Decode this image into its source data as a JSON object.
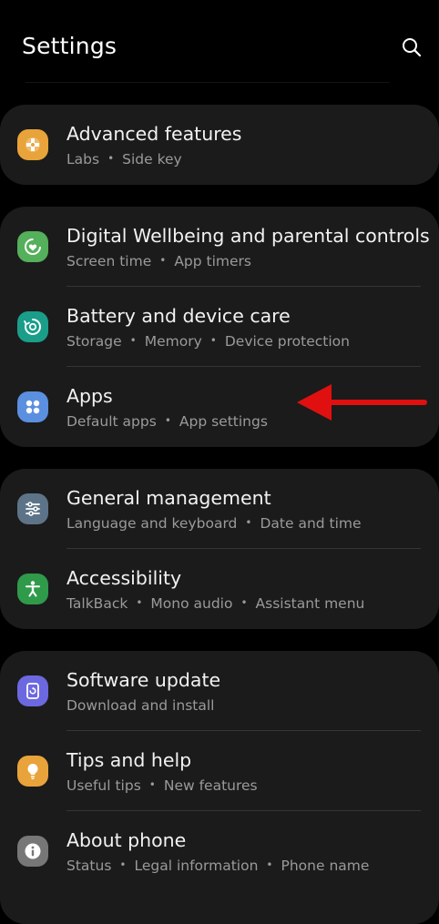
{
  "header": {
    "title": "Settings",
    "search_icon": "search-icon"
  },
  "cards": [
    {
      "items": [
        {
          "title": "Advanced features",
          "subtitle": [
            "Labs",
            "Side key"
          ],
          "icon": "plus-puzzle-icon",
          "icon_color": "#E9A33B"
        }
      ]
    },
    {
      "items": [
        {
          "title": "Digital Wellbeing and parental controls",
          "subtitle": [
            "Screen time",
            "App timers"
          ],
          "icon": "wellbeing-heart-icon",
          "icon_color": "#54B05A"
        },
        {
          "title": "Battery and device care",
          "subtitle": [
            "Storage",
            "Memory",
            "Device protection"
          ],
          "icon": "device-care-icon",
          "icon_color": "#1A9E8A"
        },
        {
          "title": "Apps",
          "subtitle": [
            "Default apps",
            "App settings"
          ],
          "icon": "apps-grid-icon",
          "icon_color": "#5B8FE0"
        }
      ]
    },
    {
      "items": [
        {
          "title": "General management",
          "subtitle": [
            "Language and keyboard",
            "Date and time"
          ],
          "icon": "sliders-icon",
          "icon_color": "#5D7488"
        },
        {
          "title": "Accessibility",
          "subtitle": [
            "TalkBack",
            "Mono audio",
            "Assistant menu"
          ],
          "icon": "accessibility-person-icon",
          "icon_color": "#2F9A4A"
        }
      ]
    },
    {
      "items": [
        {
          "title": "Software update",
          "subtitle": [
            "Download and install"
          ],
          "icon": "software-update-icon",
          "icon_color": "#6C68E0"
        },
        {
          "title": "Tips and help",
          "subtitle": [
            "Useful tips",
            "New features"
          ],
          "icon": "lightbulb-icon",
          "icon_color": "#E9A33B"
        },
        {
          "title": "About phone",
          "subtitle": [
            "Status",
            "Legal information",
            "Phone name"
          ],
          "icon": "info-icon",
          "icon_color": "#777777"
        }
      ]
    }
  ],
  "annotation": {
    "arrow_icon": "red-arrow-icon",
    "arrow_color": "#E01010",
    "points_to": "Apps"
  }
}
